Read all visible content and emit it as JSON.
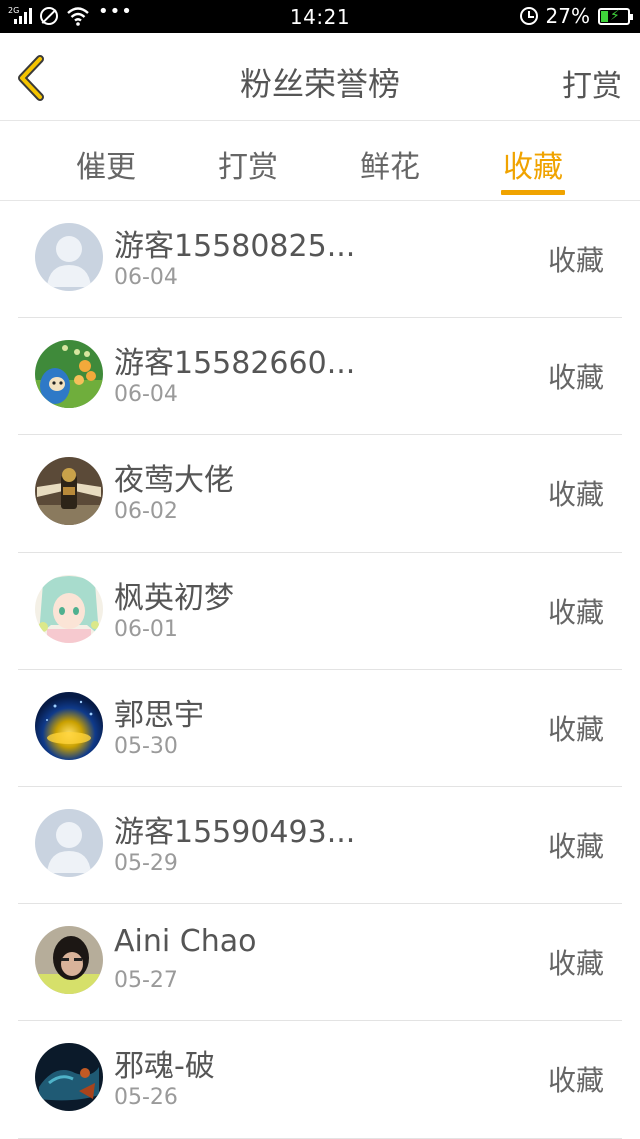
{
  "status_bar": {
    "network": "2G",
    "time": "14:21",
    "battery": "27%",
    "battery_level": 0.27,
    "icons": [
      "signal-icon",
      "dnd-icon",
      "wifi-icon",
      "more-dots-icon",
      "alarm-icon",
      "battery-charging-icon"
    ]
  },
  "header": {
    "title": "粉丝荣誉榜",
    "right_action": "打赏",
    "back_icon": "chevron-left-icon",
    "accent_color": "#f0a300"
  },
  "tabs": [
    {
      "label": "催更",
      "active": false
    },
    {
      "label": "打赏",
      "active": false
    },
    {
      "label": "鲜花",
      "active": false
    },
    {
      "label": "收藏",
      "active": true
    }
  ],
  "rows": [
    {
      "name": "游客15580825...",
      "date": "06-04",
      "action": "收藏",
      "avatar": "default-avatar"
    },
    {
      "name": "游客15582660...",
      "date": "06-04",
      "action": "收藏",
      "avatar": "cartoon-avatar"
    },
    {
      "name": "夜莺大佬",
      "date": "06-02",
      "action": "收藏",
      "avatar": "figure-avatar"
    },
    {
      "name": "枫英初梦",
      "date": "06-01",
      "action": "收藏",
      "avatar": "anime-avatar"
    },
    {
      "name": "郭思宇",
      "date": "05-30",
      "action": "收藏",
      "avatar": "space-avatar"
    },
    {
      "name": "游客15590493...",
      "date": "05-29",
      "action": "收藏",
      "avatar": "default-avatar"
    },
    {
      "name": "Aini Chao",
      "date": "05-27",
      "action": "收藏",
      "avatar": "photo-avatar"
    },
    {
      "name": "邪魂-破",
      "date": "05-26",
      "action": "收藏",
      "avatar": "dragon-avatar"
    }
  ]
}
